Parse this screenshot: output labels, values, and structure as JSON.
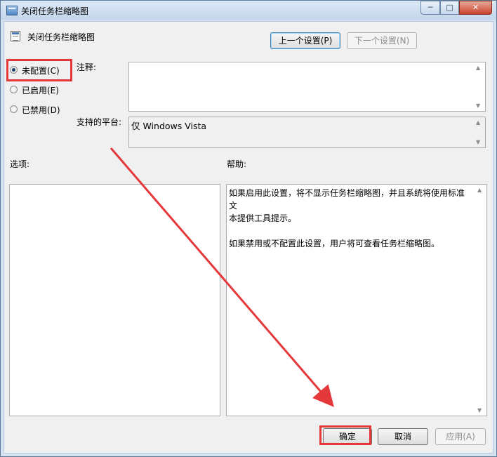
{
  "window": {
    "title": "关闭任务栏缩略图",
    "controls": {
      "minimize": "─",
      "maximize": "□",
      "close": "✕"
    }
  },
  "header": {
    "setting_name": "关闭任务栏缩略图",
    "prev_button": "上一个设置(P)",
    "next_button": "下一个设置(N)"
  },
  "state": {
    "options": [
      {
        "label": "未配置(C)",
        "checked": true
      },
      {
        "label": "已启用(E)",
        "checked": false
      },
      {
        "label": "已禁用(D)",
        "checked": false
      }
    ]
  },
  "comment": {
    "label": "注释:",
    "value": ""
  },
  "platform": {
    "label": "支持的平台:",
    "value": "仅 Windows Vista"
  },
  "options_pane": {
    "label": "选项:"
  },
  "help_pane": {
    "label": "帮助:",
    "paragraph1_line1": "如果启用此设置，将不显示任务栏缩略图，并且系统将使用标准文",
    "paragraph1_line2": "本提供工具提示。",
    "paragraph2": "如果禁用或不配置此设置，用户将可查看任务栏缩略图。"
  },
  "footer": {
    "ok_button": "确定",
    "cancel_button": "取消",
    "apply_button": "应用(A)"
  },
  "colors": {
    "annotation": "#e4383b",
    "title_bar": "#c4d6ec",
    "client_bg": "#f0f0f0"
  }
}
